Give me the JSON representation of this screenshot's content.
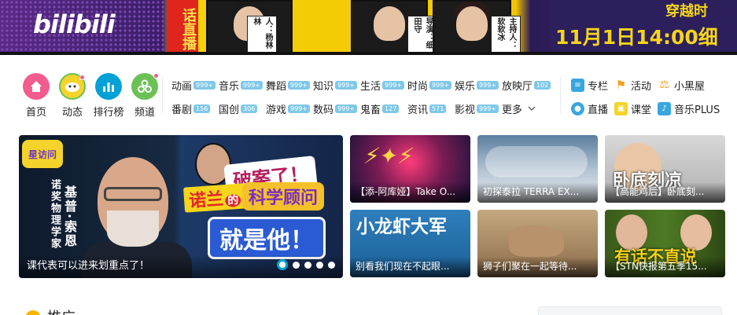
{
  "banner": {
    "logo": "bilibili",
    "live_tag": "话直播",
    "people_tags": [
      "人：杨林林",
      "导演：细田守",
      "主持人：软软冰"
    ],
    "time_text": "11月1日14:00细",
    "right_top": "穿越时"
  },
  "main_nav": [
    {
      "label": "首页",
      "icon": "home-icon",
      "color": "#f25d8e"
    },
    {
      "label": "动态",
      "icon": "dynamic-avatar-icon",
      "color": "#f4d32b"
    },
    {
      "label": "排行榜",
      "icon": "ranking-chart-icon",
      "color": "#00a1d6"
    },
    {
      "label": "频道",
      "icon": "channel-icon",
      "color": "#6bc155"
    }
  ],
  "categories": [
    [
      {
        "label": "动画",
        "badge": "999+"
      },
      {
        "label": "音乐",
        "badge": "999+"
      },
      {
        "label": "舞蹈",
        "badge": "999+"
      },
      {
        "label": "知识",
        "badge": "999+"
      },
      {
        "label": "生活",
        "badge": "999+"
      },
      {
        "label": "时尚",
        "badge": "999+"
      },
      {
        "label": "娱乐",
        "badge": "999+"
      },
      {
        "label": "放映厅",
        "badge": "102"
      }
    ],
    [
      {
        "label": "番剧",
        "badge": "156"
      },
      {
        "label": "国创",
        "badge": "306"
      },
      {
        "label": "游戏",
        "badge": "999+"
      },
      {
        "label": "数码",
        "badge": "999+"
      },
      {
        "label": "鬼畜",
        "badge": "127"
      },
      {
        "label": "资讯",
        "badge": "571"
      },
      {
        "label": "影视",
        "badge": "999+"
      },
      {
        "label": "更多",
        "badge": ""
      }
    ]
  ],
  "side_links": [
    {
      "label": "专栏",
      "icon": "column-icon",
      "color": "#3aa6e0"
    },
    {
      "label": "活动",
      "icon": "flag-icon",
      "color": "#f0a020"
    },
    {
      "label": "小黑屋",
      "icon": "blackroom-icon",
      "color": "#f0a020"
    },
    {
      "label": "直播",
      "icon": "live-icon",
      "color": "#3aa6e0"
    },
    {
      "label": "课堂",
      "icon": "classroom-icon",
      "color": "#f4d32b"
    },
    {
      "label": "音乐PLUS",
      "icon": "music-plus-icon",
      "color": "#3aa6e0"
    }
  ],
  "carousel": {
    "caption": "课代表可以进来划重点了！",
    "logo_text": "星访问",
    "vertical_text_1": "诺奖物理学家",
    "vertical_text_2": "基普·索恩",
    "headline_1": "破案了！",
    "headline_2": "诺兰",
    "headline_3": "的",
    "headline_4": "科学顾问",
    "headline_5": "就是他！",
    "dots": 5,
    "active_dot": 0
  },
  "thumbs": [
    {
      "caption": "【添-阿库娅】Take O...",
      "overlay": "Take O"
    },
    {
      "caption": "初探泰拉 TERRA EX...",
      "overlay": ""
    },
    {
      "caption": "【高能鸡后】卧底刻...",
      "overlay": "卧底刻凉"
    },
    {
      "caption": "别看我们现在不起眼...",
      "overlay": "小龙虾大军"
    },
    {
      "caption": "狮子们聚在一起等待...",
      "overlay": ""
    },
    {
      "caption": "【STN快报第五季15...",
      "overlay": "有话不直说"
    }
  ],
  "bottom": {
    "title": "推广"
  },
  "colors": {
    "accent_blue": "#00a1d6",
    "badge_blue": "#7fc8e8",
    "pink": "#f25d8e"
  }
}
